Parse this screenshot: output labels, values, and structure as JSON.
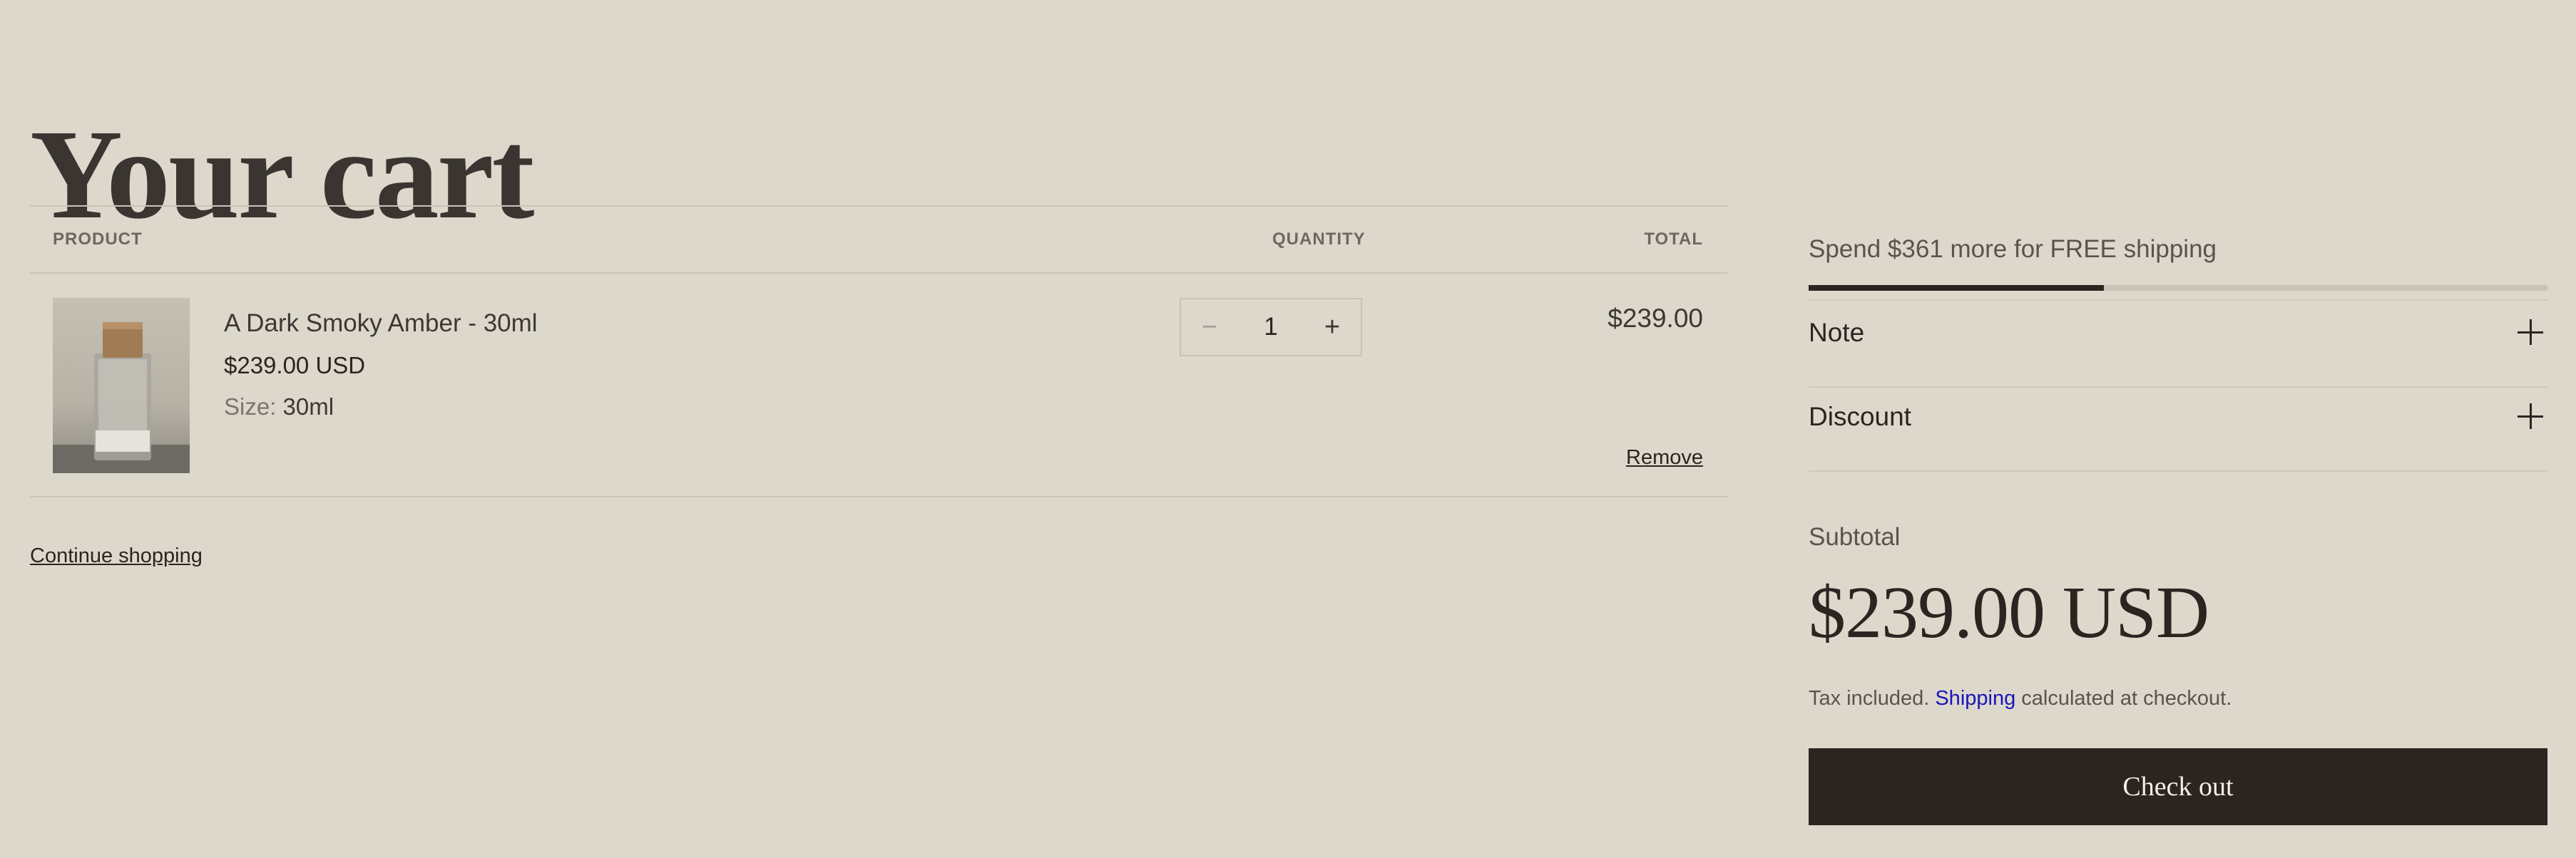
{
  "page": {
    "title": "Your cart"
  },
  "table": {
    "col_product": "PRODUCT",
    "col_quantity": "QUANTITY",
    "col_total": "TOTAL"
  },
  "items": [
    {
      "name": "A Dark Smoky Amber - 30ml",
      "price": "$239.00 USD",
      "option_label": "Size:",
      "option_value": "30ml",
      "quantity": "1",
      "line_total": "$239.00",
      "remove_label": "Remove",
      "decrease_glyph": "−",
      "increase_glyph": "+",
      "image_icon": "perfume-bottle-icon"
    }
  ],
  "continue_label": "Continue shopping",
  "summary": {
    "shipping_message": "Spend $361 more for FREE shipping",
    "shipping_progress": 0.4,
    "note_label": "Note",
    "discount_label": "Discount",
    "subtotal_label": "Subtotal",
    "subtotal_value": "$239.00 USD",
    "tax_prefix": "Tax included.",
    "tax_link": "Shipping",
    "tax_suffix": "calculated at checkout.",
    "checkout_label": "Check out"
  },
  "colors": {
    "background": "#ddd8cc",
    "text": "#2b2522",
    "checkout_bg": "#2b2421",
    "link": "#1b16b8"
  }
}
